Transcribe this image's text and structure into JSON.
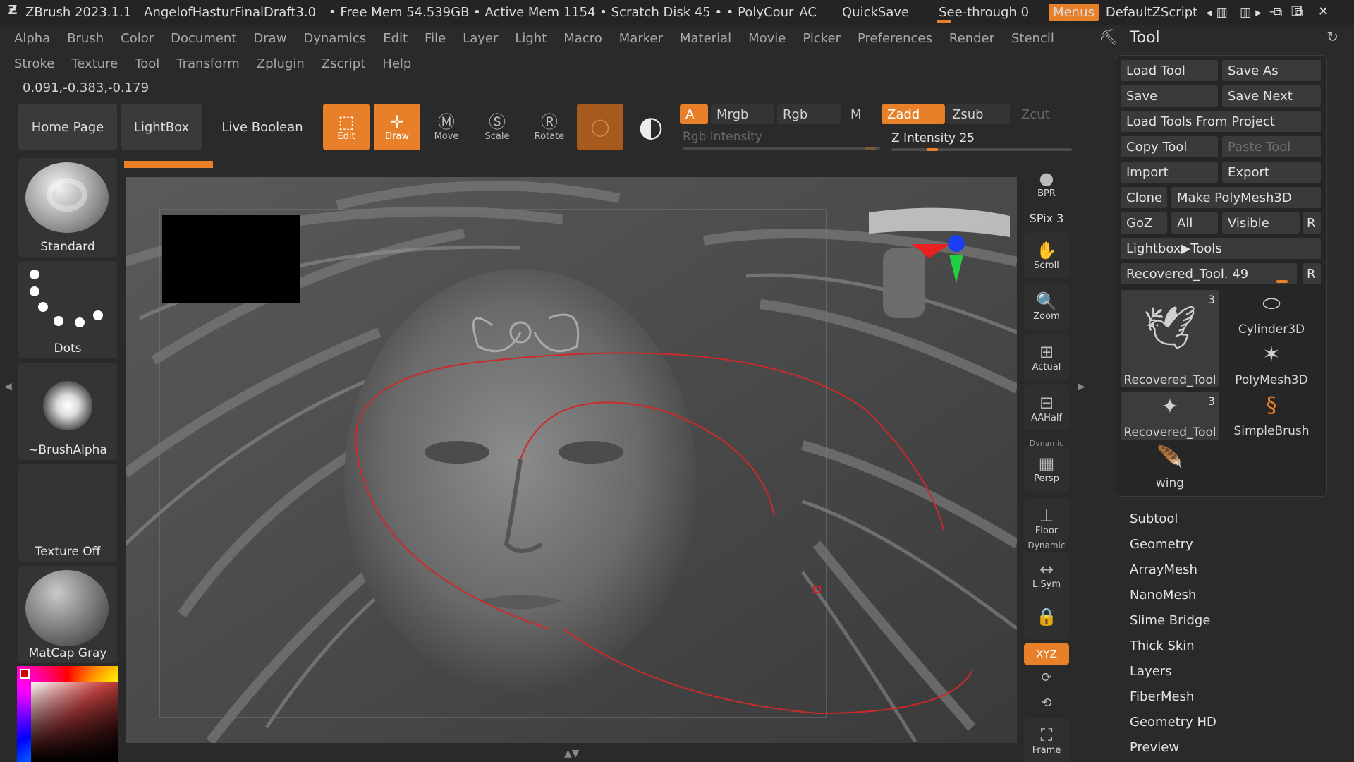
{
  "titlebar": {
    "app": "ZBrush 2023.1.1",
    "file": "AngelofHasturFinalDraft3.0",
    "stats": "• Free Mem 54.539GB • Active Mem 1154 • Scratch Disk 45 • • PolyCour",
    "ac": "AC",
    "quicksave": "QuickSave",
    "seethrough": "See-through  0",
    "menus": "Menus",
    "script": "DefaultZScript"
  },
  "menus_row1": [
    "Alpha",
    "Brush",
    "Color",
    "Document",
    "Draw",
    "Dynamics",
    "Edit",
    "File",
    "Layer",
    "Light",
    "Macro",
    "Marker",
    "Material",
    "Movie",
    "Picker",
    "Preferences",
    "Render",
    "Stencil"
  ],
  "menus_row2": [
    "Stroke",
    "Texture",
    "Tool",
    "Transform",
    "Zplugin",
    "Zscript",
    "Help"
  ],
  "coords": "0.091,-0.383,-0.179",
  "shelf": {
    "home": "Home Page",
    "lightbox": "LightBox",
    "liveboolean": "Live Boolean",
    "edit": "Edit",
    "draw": "Draw",
    "move": "Move",
    "scale": "Scale",
    "rotate": "Rotate",
    "a": "A",
    "mrgb": "Mrgb",
    "rgb": "Rgb",
    "m": "M",
    "zadd": "Zadd",
    "zsub": "Zsub",
    "zcut": "Zcut",
    "rgb_intensity": "Rgb Intensity",
    "z_intensity": "Z Intensity 25",
    "z_intensity_value": 25
  },
  "left_tray": {
    "brush": "Standard",
    "stroke": "Dots",
    "alpha": "~BrushAlpha",
    "texture": "Texture Off",
    "material": "MatCap Gray"
  },
  "right_shelf": {
    "bpr": "BPR",
    "spix": "SPix 3",
    "scroll": "Scroll",
    "zoom": "Zoom",
    "actual": "Actual",
    "aahalf": "AAHalf",
    "dynamic1": "Dynamic",
    "persp": "Persp",
    "floor": "Floor",
    "dynamic2": "Dynamic",
    "lsym": "L.Sym",
    "xyz": "XYZ",
    "frame": "Frame"
  },
  "tool_panel": {
    "title": "Tool",
    "buttons": {
      "load_tool": "Load Tool",
      "save_as": "Save As",
      "save": "Save",
      "save_next": "Save Next",
      "load_from_project": "Load Tools From Project",
      "copy_tool": "Copy Tool",
      "paste_tool": "Paste Tool",
      "import": "Import",
      "export": "Export",
      "clone": "Clone",
      "make_polymesh": "Make PolyMesh3D",
      "goz": "GoZ",
      "all": "All",
      "visible": "Visible",
      "r": "R",
      "lightbox_tools": "Lightbox▶Tools"
    },
    "current_tool": "Recovered_Tool. 49",
    "current_tool_value": 49,
    "current_tool_r": "R",
    "thumbs": [
      {
        "name": "Recovered_Tool",
        "count": "3"
      },
      {
        "name": "Cylinder3D",
        "count": ""
      },
      {
        "name": "PolyMesh3D",
        "count": ""
      },
      {
        "name": "Recovered_Tool",
        "count": "3"
      },
      {
        "name": "SimpleBrush",
        "count": ""
      },
      {
        "name": "wing",
        "count": ""
      }
    ],
    "subpalettes": [
      "Subtool",
      "Geometry",
      "ArrayMesh",
      "NanoMesh",
      "Slime Bridge",
      "Thick Skin",
      "Layers",
      "FiberMesh",
      "Geometry HD",
      "Preview"
    ]
  },
  "colors": {
    "accent": "#e8802a",
    "panel": "#262626",
    "button": "#3a3a3a"
  }
}
